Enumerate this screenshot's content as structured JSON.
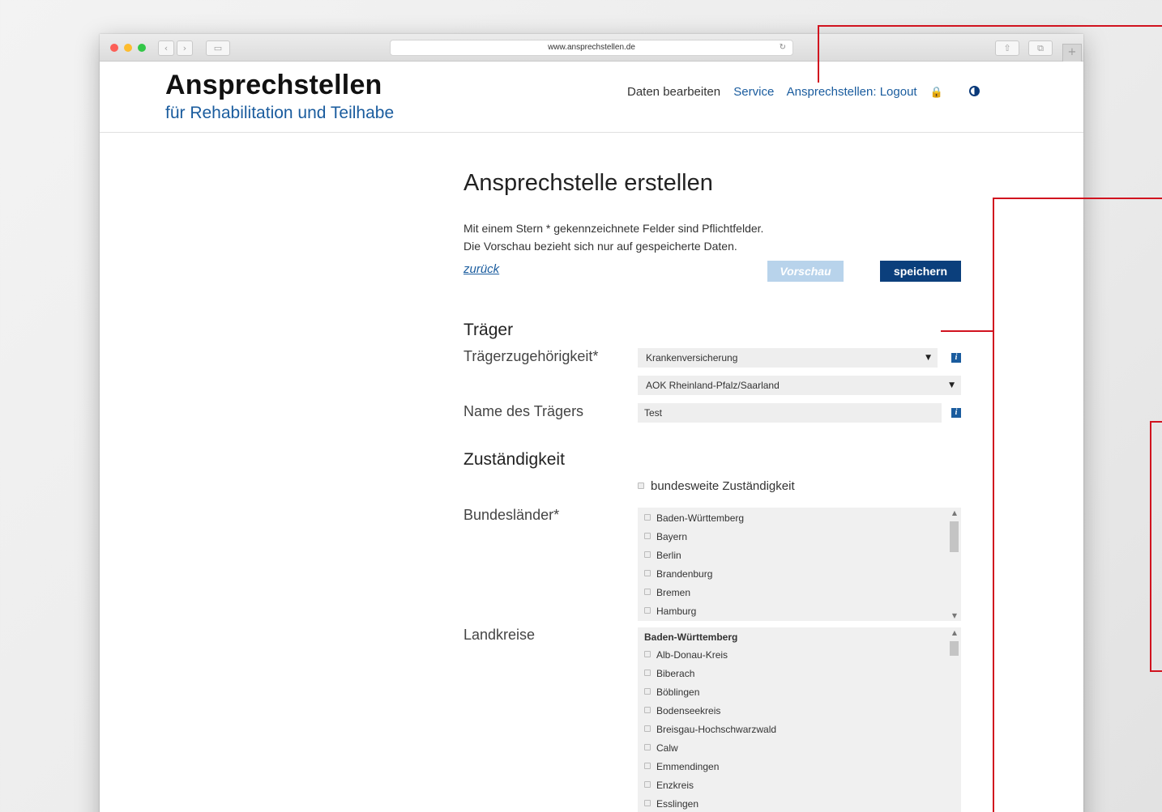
{
  "browser": {
    "url": "www.ansprechstellen.de",
    "back_glyph": "‹",
    "forward_glyph": "›",
    "sidebar_glyph": "▭",
    "share_glyph": "⇧",
    "tabs_glyph": "⧉",
    "reload_glyph": "↻",
    "new_tab_glyph": "+"
  },
  "header": {
    "logo_title": "Ansprechstellen",
    "logo_subtitle": "für Rehabilitation und Teilhabe",
    "nav": {
      "edit": "Daten bearbeiten",
      "service": "Service",
      "logout": "Ansprechstellen: Logout",
      "lock_icon": "🔒"
    }
  },
  "form": {
    "title": "Ansprechstelle erstellen",
    "hint_line1": "Mit einem Stern * gekennzeichnete Felder sind Pflichtfelder.",
    "hint_line2": "Die Vorschau bezieht sich nur auf gespeicherte Daten.",
    "back_link": "zurück",
    "preview_button": "Vorschau",
    "save_button": "speichern",
    "traeger": {
      "section_title": "Träger",
      "affiliation_label": "Trägerzugehörigkeit*",
      "affiliation_value": "Krankenversicherung",
      "sub_value": "AOK Rheinland-Pfalz/Saarland",
      "name_label": "Name des Trägers",
      "name_value": "Test",
      "info_glyph": "i"
    },
    "zustaendigkeit": {
      "section_title": "Zuständigkeit",
      "nationwide_label": "bundesweite Zuständigkeit",
      "states_label": "Bundesländer*",
      "states": [
        "Baden-Württemberg",
        "Bayern",
        "Berlin",
        "Brandenburg",
        "Bremen",
        "Hamburg"
      ],
      "districts_label": "Landkreise",
      "districts_group": "Baden-Württemberg",
      "districts": [
        "Alb-Donau-Kreis",
        "Biberach",
        "Böblingen",
        "Bodenseekreis",
        "Breisgau-Hochschwarzwald",
        "Calw",
        "Emmendingen",
        "Enzkreis",
        "Esslingen"
      ]
    }
  },
  "colors": {
    "accent_blue": "#1a5c9e",
    "save_button_bg": "#0b3f7c",
    "preview_button_bg": "#b8d3eb",
    "annotation_red": "#d1131f"
  }
}
